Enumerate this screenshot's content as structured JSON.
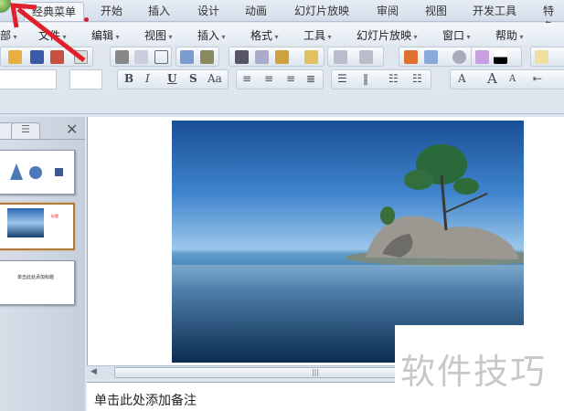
{
  "ribbon_tabs": [
    "经典菜单",
    "开始",
    "插入",
    "设计",
    "动画",
    "幻灯片放映",
    "审阅",
    "视图",
    "开发工具",
    "特色"
  ],
  "menu": [
    "部",
    "文件",
    "编辑",
    "视图",
    "插入",
    "格式",
    "工具",
    "幻灯片放映",
    "窗口",
    "帮助"
  ],
  "format_buttons": [
    "B",
    "I",
    "U",
    "S",
    "Aa",
    "A",
    "A",
    "A"
  ],
  "slides": [
    {
      "label": "slide-1"
    },
    {
      "label": "slide-2",
      "caption": "标题"
    },
    {
      "label": "slide-3",
      "text": "单击此处添加标题"
    }
  ],
  "close_glyph": "✕",
  "notes_placeholder": "单击此处添加备注",
  "watermark": "软件技巧",
  "colors": {
    "accent_arrow": "#e0202a",
    "selected_border": "#b07a3a"
  }
}
